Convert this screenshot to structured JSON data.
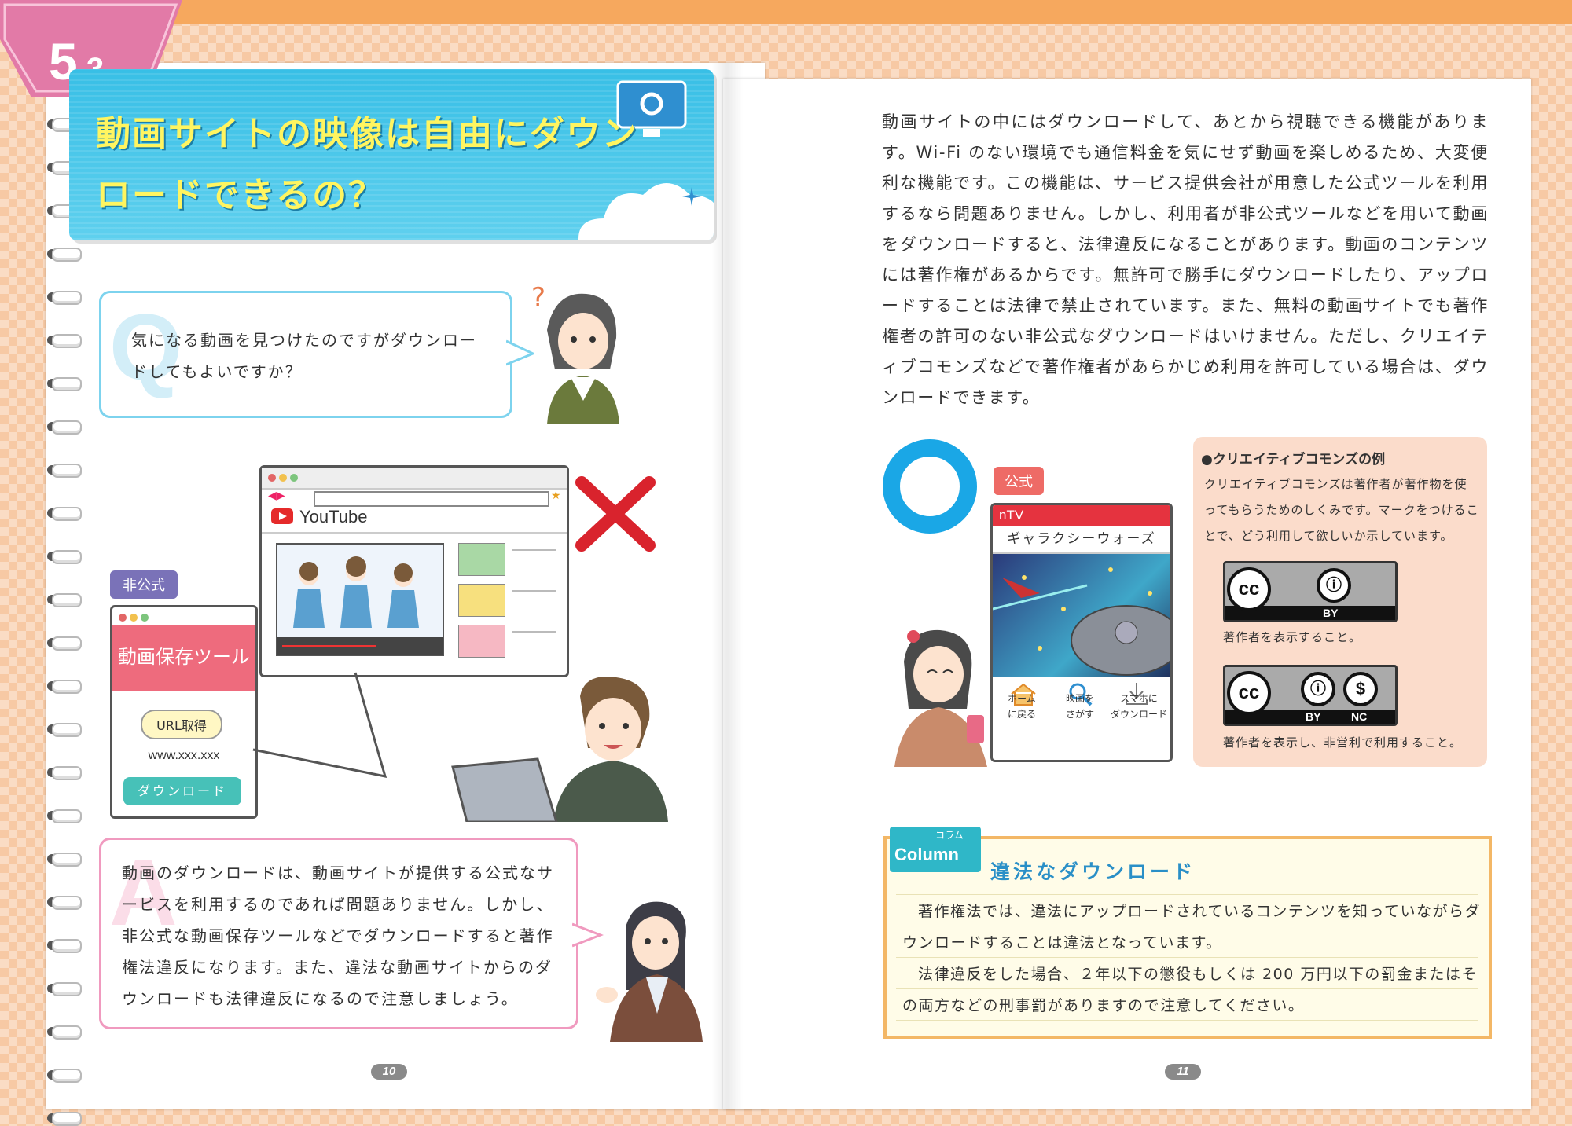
{
  "section": {
    "number": "5",
    "sub": "-3"
  },
  "title": {
    "line1": "動画サイトの映像は自由にダウン",
    "line2": "ロードできるの？"
  },
  "question": {
    "letter": "Q",
    "text": "気になる動画を見つけたのですがダウンロードしてもよいですか？"
  },
  "browser": {
    "site": "YouTube"
  },
  "unofficial": {
    "tag": "非公式",
    "tool_name": "動画保存ツール",
    "url_button": "URL取得",
    "url_text": "www.xxx.xxx",
    "download_button": "ダウンロード"
  },
  "answer": {
    "letter": "A",
    "text": "動画のダウンロードは、動画サイトが提供する公式なサービスを利用するのであれば問題ありません。しかし、非公式な動画保存ツールなどでダウンロードすると著作権法違反になります。また、違法な動画サイトからのダウンロードも法律違反になるので注意しましょう。"
  },
  "body": "動画サイトの中にはダウンロードして、あとから視聴できる機能があります。Wi-Fi のない環境でも通信料金を気にせず動画を楽しめるため、大変便利な機能です。この機能は、サービス提供会社が用意した公式ツールを利用するなら問題ありません。しかし、利用者が非公式ツールなどを用いて動画をダウンロードすると、法律違反になることがあります。動画のコンテンツには著作権があるからです。無許可で勝手にダウンロードしたり、アップロードすることは法律で禁止されています。また、無料の動画サイトでも著作権者の許可のない非公式なダウンロードはいけません。ただし、クリエイティブコモンズなどで著作権者があらかじめ利用を許可している場合は、ダウンロードできます。",
  "official": {
    "tag": "公式",
    "app_name": "nTV",
    "show_title": "ギャラクシーウォーズ",
    "menu": [
      {
        "line1": "ホーム",
        "line2": "に戻る"
      },
      {
        "line1": "映画を",
        "line2": "さがす"
      },
      {
        "line1": "スマホに",
        "line2": "ダウンロード"
      }
    ]
  },
  "cc": {
    "title": "●クリエイティブコモンズの例",
    "desc": "クリエイティブコモンズは著作者が著作物を使ってもらうためのしくみです。マークをつけることで、どう利用して欲しいか示しています。",
    "badge1": {
      "cc": "cc",
      "label": "BY",
      "caption": "著作者を表示すること。"
    },
    "badge2": {
      "cc": "cc",
      "label1": "BY",
      "label2": "NC",
      "caption": "著作者を表示し、非営利で利用すること。"
    }
  },
  "column": {
    "badge_small": "コラム",
    "badge_main": "Column",
    "title": "違法なダウンロード",
    "para1": "著作権法では、違法にアップロードされているコンテンツを知っていながらダウンロードすることは違法となっています。",
    "para2": "法律違反をした場合、２年以下の懲役もしくは 200 万円以下の罰金またはその両方などの刑事罰がありますので注意してください。"
  },
  "pages": {
    "left": "10",
    "right": "11"
  },
  "colors": {
    "accent_blue": "#38bfe6",
    "tab_pink": "#e27aa7",
    "title_yellow": "#fff560",
    "column_orange": "#f3b766"
  }
}
